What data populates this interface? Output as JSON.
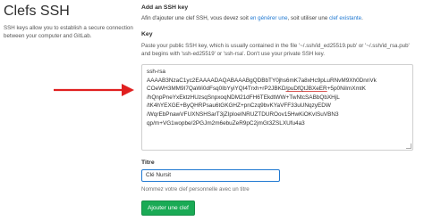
{
  "section": {
    "title": "Clefs SSH",
    "description": "SSH keys allow you to establish a secure connection between your computer and GitLab."
  },
  "add_key": {
    "title": "Add an SSH key",
    "text_before": "Afin d'ajouter une clef SSH, vous devez soit ",
    "link_generate": "en générer une",
    "text_middle": ", soit utiliser une ",
    "link_existing": "clef existante",
    "text_after": "."
  },
  "key_field": {
    "label": "Key",
    "hint": "Paste your public SSH key, which is usually contained in the file '~/.ssh/id_ed25519.pub' or '~/.ssh/id_rsa.pub' and begins with 'ssh-ed25519' or 'ssh-rsa'. Don't use your private SSH key.",
    "value_line1": "ssh-rsa",
    "value_line2": "AAAAB3NzaC1yc2EAAAADAQABAAABgQDBbTY0jhs6mK7a8xHc9pLuRNvM9Xh0DnnVk",
    "value_line3a": "COeWH3MM9I7QaWi0dFsq0IbYyiYQI4Trxh+rP2JBKD",
    "value_line3b": "/puDfQtJBXeER",
    "value_line3c": "+5p0NiImXmtK",
    "value_line4": "/hQnpPneYxEktzHUzsqSnpxoqNDM21dFH6TEkdtWW+TwNtcSABbQbXHjL",
    "value_line5": "/tK4hYEXGE+ByQHRPsau6tGKGHZ+pnCzq9bvKYaVFF33uUNqzyEDW",
    "value_line6": "/WqrEbPnawVFUXNSHSarT3jZIpIoeINRUZTDUROov15HwKiOKvISuVBN3",
    "value_line7": "qp/m+VG1wopbe/2PGJm2m6ebuZeR9pC2jmGt3ZSLXUfu4a3"
  },
  "title_field": {
    "label": "Titre",
    "value": "Clé Nursit",
    "hint": "Nommez votre clef personnelle avec un titre"
  },
  "submit": {
    "label": "Ajouter une clef"
  },
  "colors": {
    "link": "#1f78d1",
    "button": "#1aaa55",
    "arrow": "#e02020"
  }
}
